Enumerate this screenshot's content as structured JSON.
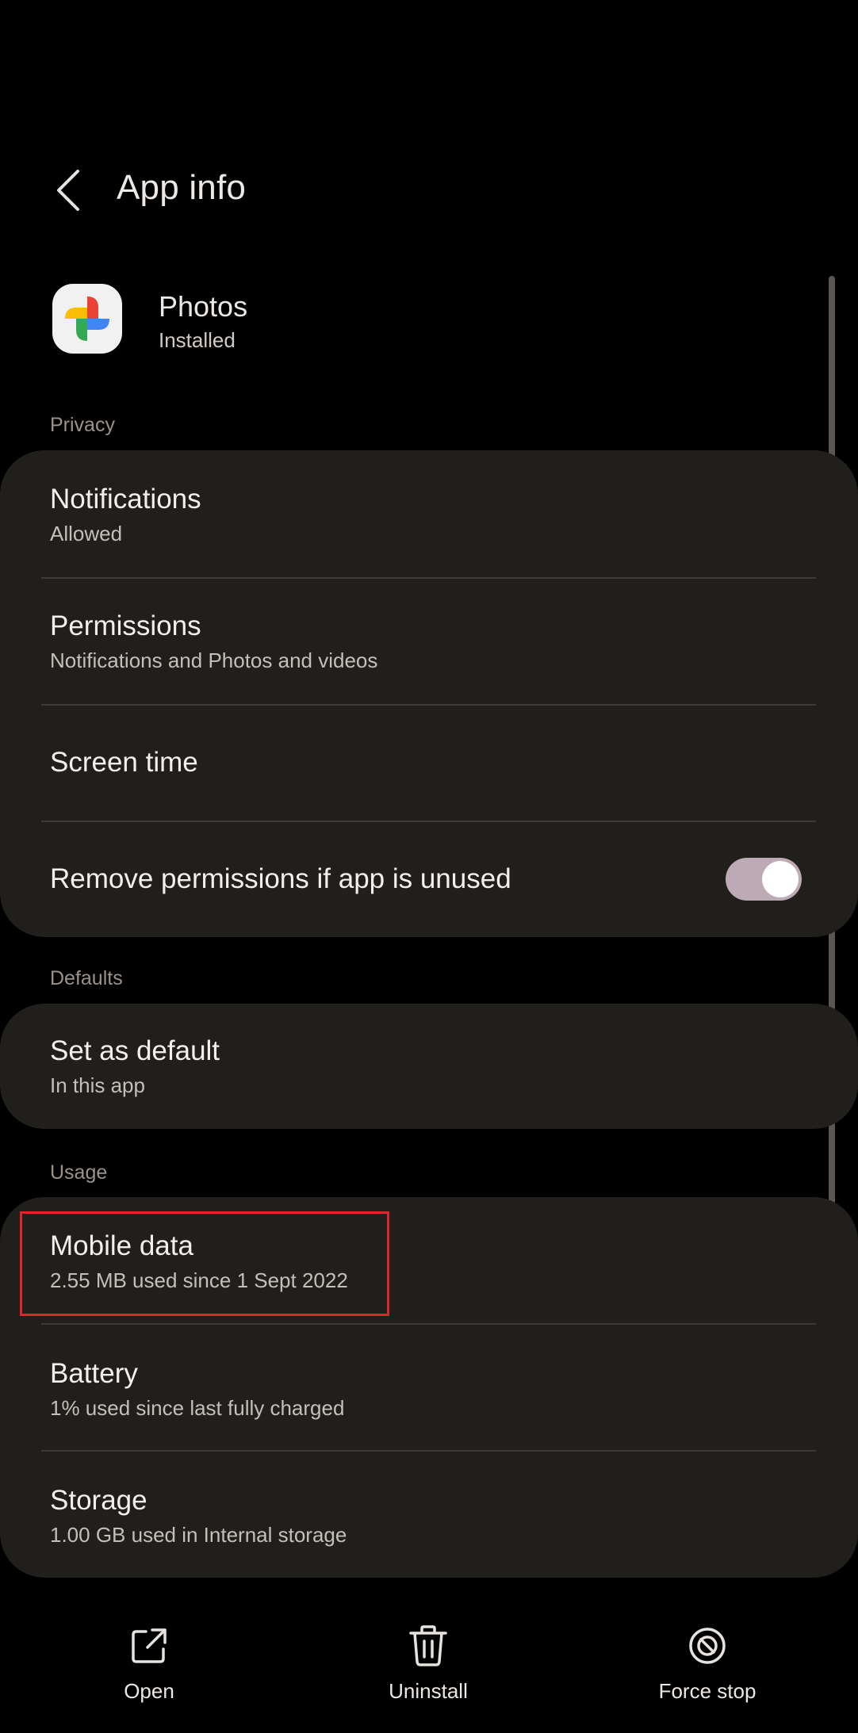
{
  "header": {
    "title": "App info",
    "back_icon": "chevron-left-icon"
  },
  "app": {
    "name": "Photos",
    "status": "Installed",
    "icon": "google-photos-pinwheel-icon"
  },
  "sections": {
    "privacy": {
      "label": "Privacy",
      "items": [
        {
          "title": "Notifications",
          "subtitle": "Allowed"
        },
        {
          "title": "Permissions",
          "subtitle": "Notifications and Photos and videos"
        },
        {
          "title": "Screen time"
        },
        {
          "title": "Remove permissions if app is unused",
          "toggle_on": true
        }
      ]
    },
    "defaults": {
      "label": "Defaults",
      "items": [
        {
          "title": "Set as default",
          "subtitle": "In this app"
        }
      ]
    },
    "usage": {
      "label": "Usage",
      "items": [
        {
          "title": "Mobile data",
          "subtitle": "2.55 MB used since 1 Sept 2022"
        },
        {
          "title": "Battery",
          "subtitle": "1% used since last fully charged"
        },
        {
          "title": "Storage",
          "subtitle": "1.00 GB used in Internal storage"
        }
      ]
    }
  },
  "bottom_actions": [
    {
      "label": "Open",
      "icon": "open-external-icon"
    },
    {
      "label": "Uninstall",
      "icon": "trash-icon"
    },
    {
      "label": "Force stop",
      "icon": "force-stop-icon"
    }
  ],
  "colors": {
    "background": "#000000",
    "card": "#211f1c",
    "toggle_track": "#bcaab4",
    "highlight_border": "#e0242e"
  }
}
